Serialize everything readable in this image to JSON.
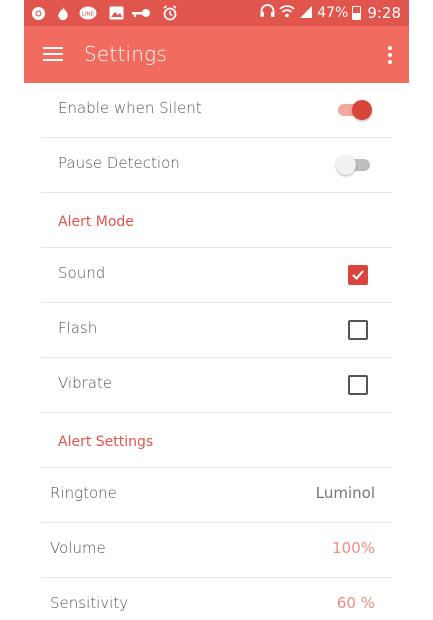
{
  "status_bar": {
    "icons": [
      "chrome-icon",
      "fire-icon",
      "line-app-icon",
      "image-icon",
      "key-icon",
      "alarm-clock-icon"
    ],
    "battery_percent": "47%",
    "time": "9:28"
  },
  "app_bar": {
    "title": "Settings",
    "menu_icon": "hamburger-menu-icon",
    "overflow_icon": "more-vertical-icon"
  },
  "general": {
    "enable_when_silent": {
      "label": "Enable when Silent",
      "on": true
    },
    "pause_detection": {
      "label": "Pause Detection",
      "on": false
    }
  },
  "alert_mode": {
    "header": "Alert Mode",
    "items": [
      {
        "label": "Sound",
        "checked": true
      },
      {
        "label": "Flash",
        "checked": false
      },
      {
        "label": "Vibrate",
        "checked": false
      }
    ]
  },
  "alert_settings": {
    "header": "Alert Settings",
    "ringtone": {
      "label": "Ringtone",
      "value": "Luminol"
    },
    "volume": {
      "label": "Volume",
      "value": "100%"
    },
    "sensitivity": {
      "label": "Sensitivity",
      "value": "60 %"
    }
  },
  "colors": {
    "status_bar": "#e0554c",
    "app_bar": "#f26b5f",
    "accent": "#d9453c",
    "accent_light": "#f28a80"
  }
}
